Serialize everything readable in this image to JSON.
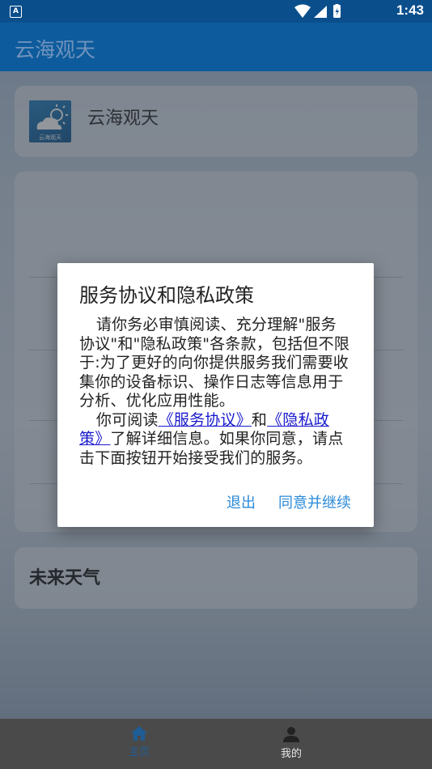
{
  "status_bar": {
    "app_badge": "A",
    "time": "1:43",
    "icons": [
      "wifi-icon",
      "signal-icon",
      "battery-icon"
    ]
  },
  "app_bar": {
    "title": "云海观天"
  },
  "header_card": {
    "app_name": "云海观天",
    "logo_text": "云海观天"
  },
  "future_card": {
    "label": "未来天气"
  },
  "bottom_nav": {
    "items": [
      {
        "label": "主页",
        "icon": "home-icon",
        "active": true
      },
      {
        "label": "我的",
        "icon": "person-icon",
        "active": false
      }
    ]
  },
  "dialog": {
    "title": "服务协议和隐私政策",
    "para1": "请你务必审慎阅读、充分理解\"服务协议\"和\"隐私政策\"各条款，包括但不限于:为了更好的向你提供服务我们需要收集你的设备标识、操作日志等信息用于分析、优化应用性能。",
    "para2_prefix": "你可阅读",
    "service_link": "《服务协议》",
    "and_text": "和",
    "privacy_link": "《隐私政策》",
    "para2_suffix": "了解详细信息。如果你同意，请点击下面按钮开始接受我们的服务。",
    "exit_button": "退出",
    "agree_button": "同意并继续"
  },
  "colors": {
    "primary": "#0d5b9c",
    "status_bar": "#0a4f8c",
    "dialog_button": "#2a8ad8",
    "link": "#1a1acd",
    "bottom_nav": "#4a4a4a"
  }
}
